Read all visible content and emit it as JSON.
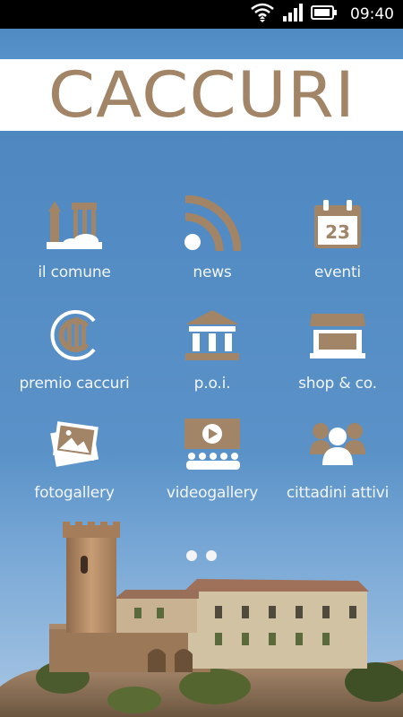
{
  "status_bar": {
    "time": "09:40",
    "icons": [
      "wifi-icon",
      "signal-icon",
      "battery-icon"
    ]
  },
  "app": {
    "title": "CACCURI"
  },
  "colors": {
    "accent": "#a28467",
    "background": "#5b92c8",
    "label_text": "#f2f6fb"
  },
  "menu": {
    "items": [
      {
        "label": "il comune",
        "icon": "town-hall-icon"
      },
      {
        "label": "news",
        "icon": "rss-feed-icon"
      },
      {
        "label": "eventi",
        "icon": "calendar-icon",
        "calendar_day": "23"
      },
      {
        "label": "premio caccuri",
        "icon": "award-logo-icon"
      },
      {
        "label": "p.o.i.",
        "icon": "monument-icon"
      },
      {
        "label": "shop & co.",
        "icon": "shop-icon"
      },
      {
        "label": "fotogallery",
        "icon": "photos-icon"
      },
      {
        "label": "videogallery",
        "icon": "video-audience-icon"
      },
      {
        "label": "cittadini attivi",
        "icon": "citizens-group-icon"
      }
    ]
  },
  "pager": {
    "pages": 2,
    "current": 1
  }
}
